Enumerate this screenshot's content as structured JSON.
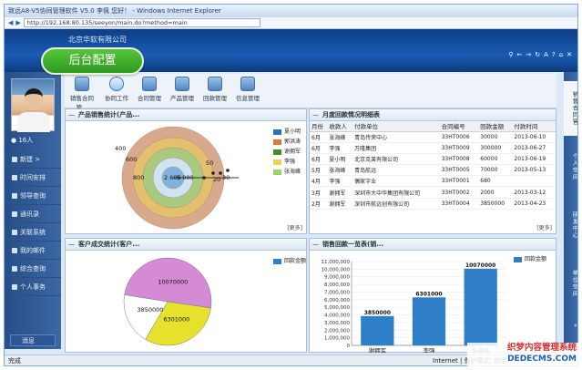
{
  "window": {
    "title": "致远A8-V5协同管理软件 V5.0 李佩 您好！ - Windows Internet Explorer",
    "url": "http://192.168.80.135/seeyon/main.do?method=main"
  },
  "header": {
    "company": "北京华软有限公司",
    "badge": "后台配置",
    "icons": [
      "search-icon",
      "back-icon",
      "forward-icon",
      "refresh-icon",
      "font-size-icon",
      "help-icon",
      "home-icon",
      "close-icon"
    ]
  },
  "user": {
    "count": "16人"
  },
  "nav": {
    "items": [
      {
        "label": "新建 >"
      },
      {
        "label": "时间安排"
      },
      {
        "label": "领导查询"
      },
      {
        "label": "通讯录"
      },
      {
        "label": "关联系统"
      },
      {
        "label": "我的邮件"
      },
      {
        "label": "综合查询"
      },
      {
        "label": "个人事务"
      }
    ],
    "message": "消息"
  },
  "toolbar": {
    "items": [
      {
        "label": "销售合同管..."
      },
      {
        "label": "协同工作"
      },
      {
        "label": "合同管理"
      },
      {
        "label": "产品管理"
      },
      {
        "label": "回款管理"
      },
      {
        "label": "信息管理"
      }
    ]
  },
  "panels": {
    "product_sales": {
      "title": "产品销售统计(产品...",
      "more": "[更多]"
    },
    "monthly_payment": {
      "title": "月度回款情况明细表",
      "columns": [
        "月份",
        "收款人",
        "付款单位",
        "合同编号",
        "回款金额",
        "付款时间"
      ],
      "rows": [
        [
          "6月",
          "张海峰",
          "青岛传荣中心",
          "33HT0006",
          "30000",
          "2013-06-10"
        ],
        [
          "6月",
          "李强",
          "万隆集团",
          "33HT0009",
          "300000",
          "2013-06-27"
        ],
        [
          "6月",
          "夏小明",
          "北京克莱有限公司",
          "33HT0008",
          "60000",
          "2013-06-19"
        ],
        [
          "5月",
          "张海峰",
          "青岛航远",
          "33HT0005",
          "70000",
          "2013-05-13"
        ],
        [
          "4月",
          "李强",
          "偶家字业",
          "33HT0001",
          "680",
          ""
        ],
        [
          "3月",
          "谢拥军",
          "深圳市大中华集团有限公司",
          "33HT0002",
          "2000",
          "2013-03-12"
        ],
        [
          "2月",
          "谢拥军",
          "深圳市航远创有限公司",
          "33HT0004",
          "3850000",
          "2013-04-23"
        ]
      ],
      "more": "[更多]"
    },
    "customer": {
      "title": "客户成交统计(客户...",
      "more": "[更多]"
    },
    "sales_payment": {
      "title": "销售回款一览表(销..."
    }
  },
  "right_tabs": [
    "销售合同管",
    "个人空间",
    "研发中心",
    "单位空间"
  ],
  "statusbar": {
    "left": "完成",
    "right": "Internet | 保护模式: 禁用"
  },
  "watermark": {
    "line1": "织梦内容管理系统",
    "line2": "DEDECMS.COM"
  },
  "chart_data": [
    {
      "type": "pie",
      "title": "产品销售统计(产品...",
      "series": [
        {
          "name": "夏小明",
          "color": "#2f6fb6"
        },
        {
          "name": "郭洪涛",
          "color": "#e07a3c"
        },
        {
          "name": "谢拥军",
          "color": "#3f8f2c"
        },
        {
          "name": "李强",
          "color": "#e6d64a"
        },
        {
          "name": "张海峰",
          "color": "#9ad270"
        }
      ],
      "rings": [
        "#d8a98c",
        "#e3c06e",
        "#a8c97e",
        "#cfe3f2",
        "#7fb3de"
      ],
      "labels": [
        "400",
        "600",
        "800",
        "2 600",
        "5 000",
        "50",
        "20",
        "30"
      ]
    },
    {
      "type": "pie",
      "title": "客户成交统计(客户...",
      "slices": [
        {
          "label": "10070000",
          "value": 10070000,
          "color": "#d58ad6"
        },
        {
          "label": "6301000",
          "value": 6301000,
          "color": "#e6e12c"
        },
        {
          "label": "3850000",
          "value": 3850000,
          "color": "#ffffff"
        }
      ]
    },
    {
      "type": "bar",
      "title": "销售回款一览表(销...",
      "categories": [
        "谢拥军",
        "李强",
        "张海峰"
      ],
      "series": [
        {
          "name": "回款金额",
          "values": [
            3850000,
            6301000,
            10070000
          ]
        }
      ],
      "ylim": [
        0,
        11000000
      ],
      "yticks": [
        "0",
        "1,000,000",
        "2,000,000",
        "3,000,000",
        "4,000,000",
        "5,000,000",
        "6,000,000",
        "7,000,000",
        "8,000,000",
        "9,000,000",
        "10,000,000",
        "11,000,000"
      ],
      "value_labels": [
        "3850000",
        "6301000",
        "10070000"
      ],
      "color": "#2f7fc8"
    }
  ]
}
